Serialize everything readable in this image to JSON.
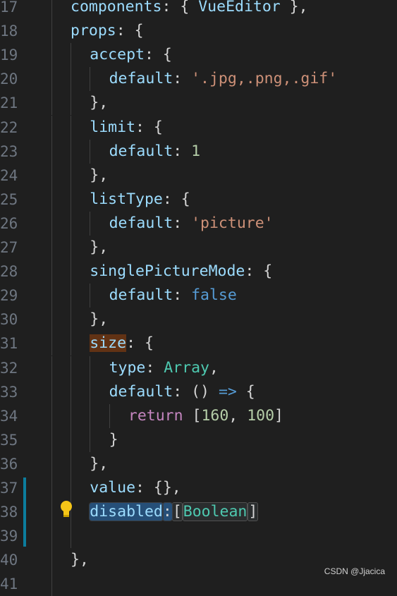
{
  "editor": {
    "lines": [
      {
        "n": "17",
        "indent": 0,
        "tokens": [
          [
            "prop",
            "components"
          ],
          [
            "punct",
            ": { "
          ],
          [
            "prop",
            "VueEditor"
          ],
          [
            "punct",
            " },"
          ]
        ]
      },
      {
        "n": "18",
        "indent": 0,
        "tokens": [
          [
            "prop",
            "props"
          ],
          [
            "punct",
            ": {"
          ]
        ]
      },
      {
        "n": "19",
        "indent": 1,
        "tokens": [
          [
            "prop",
            "accept"
          ],
          [
            "punct",
            ": {"
          ]
        ]
      },
      {
        "n": "20",
        "indent": 2,
        "tokens": [
          [
            "prop",
            "default"
          ],
          [
            "punct",
            ": "
          ],
          [
            "str",
            "'.jpg,.png,.gif'"
          ]
        ]
      },
      {
        "n": "21",
        "indent": 1,
        "tokens": [
          [
            "punct",
            "},"
          ]
        ]
      },
      {
        "n": "22",
        "indent": 1,
        "tokens": [
          [
            "prop",
            "limit"
          ],
          [
            "punct",
            ": {"
          ]
        ]
      },
      {
        "n": "23",
        "indent": 2,
        "tokens": [
          [
            "prop",
            "default"
          ],
          [
            "punct",
            ": "
          ],
          [
            "num",
            "1"
          ]
        ]
      },
      {
        "n": "24",
        "indent": 1,
        "tokens": [
          [
            "punct",
            "},"
          ]
        ]
      },
      {
        "n": "25",
        "indent": 1,
        "tokens": [
          [
            "prop",
            "listType"
          ],
          [
            "punct",
            ": {"
          ]
        ]
      },
      {
        "n": "26",
        "indent": 2,
        "tokens": [
          [
            "prop",
            "default"
          ],
          [
            "punct",
            ": "
          ],
          [
            "str",
            "'picture'"
          ]
        ]
      },
      {
        "n": "27",
        "indent": 1,
        "tokens": [
          [
            "punct",
            "},"
          ]
        ]
      },
      {
        "n": "28",
        "indent": 1,
        "tokens": [
          [
            "prop",
            "singlePictureMode"
          ],
          [
            "punct",
            ": {"
          ]
        ]
      },
      {
        "n": "29",
        "indent": 2,
        "tokens": [
          [
            "prop",
            "default"
          ],
          [
            "punct",
            ": "
          ],
          [
            "kw",
            "false"
          ]
        ]
      },
      {
        "n": "30",
        "indent": 1,
        "tokens": [
          [
            "punct",
            "},"
          ]
        ]
      },
      {
        "n": "31",
        "indent": 1,
        "tokens": [
          [
            "prop hl-size",
            "size"
          ],
          [
            "punct",
            ": {"
          ]
        ]
      },
      {
        "n": "32",
        "indent": 2,
        "tokens": [
          [
            "prop",
            "type"
          ],
          [
            "punct",
            ": "
          ],
          [
            "typ",
            "Array"
          ],
          [
            "punct",
            ","
          ]
        ]
      },
      {
        "n": "33",
        "indent": 2,
        "tokens": [
          [
            "prop",
            "default"
          ],
          [
            "punct",
            ": () "
          ],
          [
            "kw",
            "=>"
          ],
          [
            "punct",
            " {"
          ]
        ]
      },
      {
        "n": "34",
        "indent": 3,
        "tokens": [
          [
            "ctrl",
            "return"
          ],
          [
            "punct",
            " ["
          ],
          [
            "num",
            "160"
          ],
          [
            "punct",
            ", "
          ],
          [
            "num",
            "100"
          ],
          [
            "punct",
            "]"
          ]
        ]
      },
      {
        "n": "35",
        "indent": 2,
        "tokens": [
          [
            "punct",
            "}"
          ]
        ]
      },
      {
        "n": "36",
        "indent": 1,
        "tokens": [
          [
            "punct",
            "},"
          ]
        ]
      },
      {
        "n": "37",
        "indent": 1,
        "tokens": [
          [
            "prop",
            "value"
          ],
          [
            "punct",
            ": {},"
          ]
        ]
      },
      {
        "n": "38",
        "indent": 1,
        "tokens": [
          [
            "prop hl-sel",
            "disabled"
          ],
          [
            "punct hl-sel",
            ":"
          ],
          [
            "punct hl-box",
            "["
          ],
          [
            "typ hl-box",
            "Boolean"
          ],
          [
            "punct hl-box",
            "]"
          ]
        ]
      },
      {
        "n": "39",
        "indent": 1,
        "tokens": []
      },
      {
        "n": "40",
        "indent": 0,
        "tokens": [
          [
            "punct",
            "},"
          ]
        ]
      },
      {
        "n": "41",
        "indent": 0,
        "tokens": []
      }
    ],
    "icons": {
      "lightbulb": "lightbulb-icon"
    }
  },
  "watermark": "CSDN @Jjacica"
}
